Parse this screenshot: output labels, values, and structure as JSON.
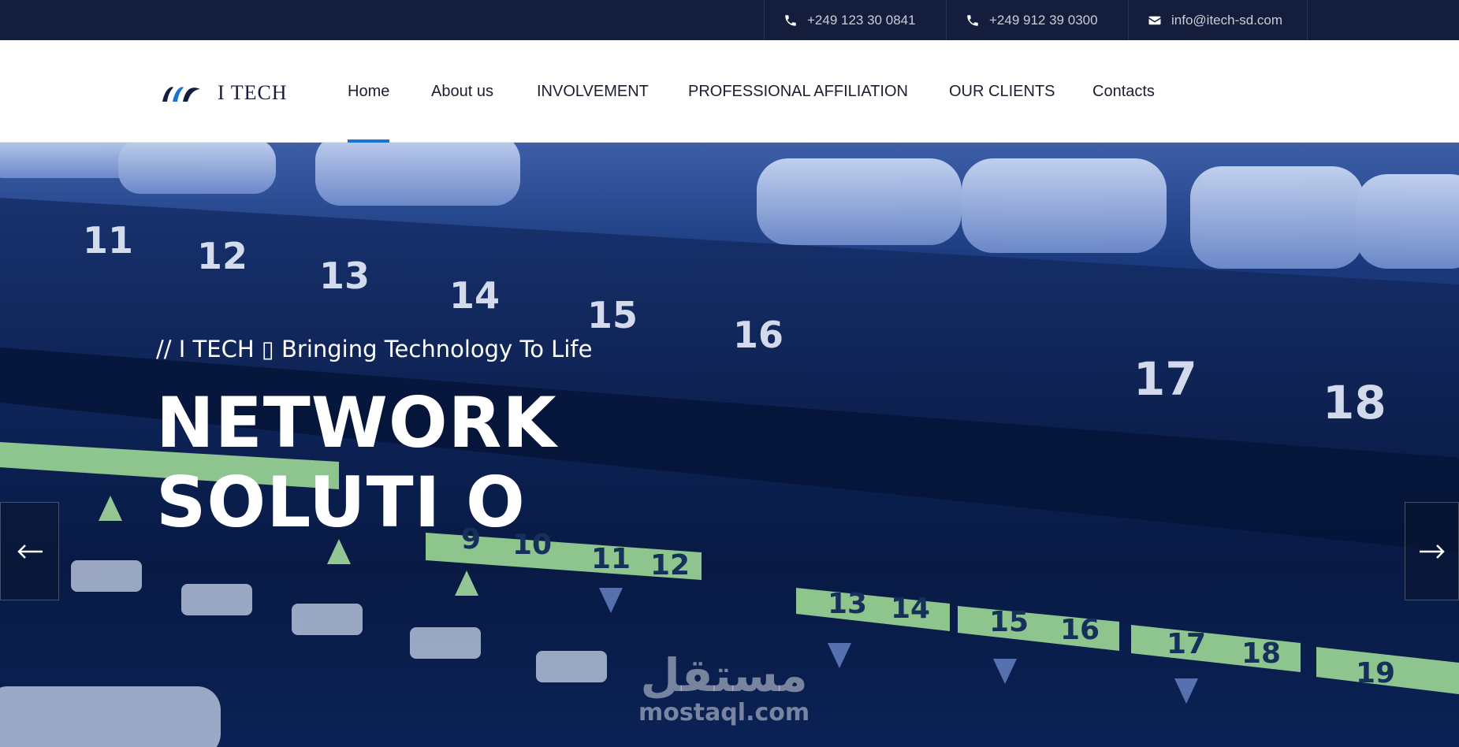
{
  "topbar": {
    "contacts": [
      {
        "icon": "phone-icon",
        "text": "+249 123 30 0841"
      },
      {
        "icon": "phone-icon",
        "text": "+249 912 39 0300"
      },
      {
        "icon": "mail-icon",
        "text": "info@itech-sd.com"
      }
    ]
  },
  "header": {
    "logo_text": "I TECH",
    "nav": [
      {
        "label": "Home",
        "active": true
      },
      {
        "label": "About us"
      },
      {
        "label": "INVOLVEMENT"
      },
      {
        "label": "PROFESSIONAL AFFILIATION"
      },
      {
        "label": "OUR CLIENTS"
      },
      {
        "label": "Contacts"
      }
    ],
    "accent_color": "#1a73d9"
  },
  "hero": {
    "subtitle": "// I TECH ▯ Bringing Technology To Life",
    "title_line1": "NETWORK",
    "title_line2": "SOLUTI  O",
    "prev_icon": "arrow-left-icon",
    "next_icon": "arrow-right-icon",
    "port_numbers_top": [
      "11",
      "12",
      "13",
      "14",
      "15",
      "16",
      "17",
      "18"
    ],
    "port_numbers_bottom": [
      "9",
      "10",
      "11",
      "12",
      "13",
      "14",
      "15",
      "16",
      "17",
      "18",
      "19"
    ]
  },
  "watermark": {
    "arabic": "مستقل",
    "latin": "mostaql.com"
  },
  "colors": {
    "topbar_bg": "#141d3c",
    "hero_bg": "#0d2356",
    "port_green": "#a6e39a"
  }
}
